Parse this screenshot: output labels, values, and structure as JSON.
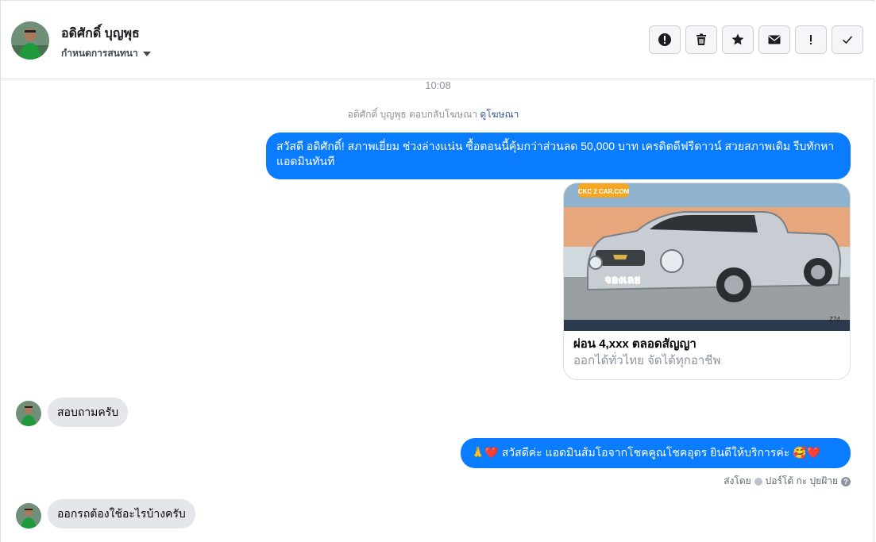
{
  "header": {
    "name": "อดิศักดิ์ บุญพุธ",
    "subtitle": "กำหนดการสนทนา",
    "toolbar": [
      {
        "icon": "alert-circle-icon"
      },
      {
        "icon": "trash-icon"
      },
      {
        "icon": "star-icon"
      },
      {
        "icon": "mail-icon"
      },
      {
        "icon": "exclamation-icon"
      },
      {
        "icon": "checkmark-icon"
      }
    ]
  },
  "conversation": {
    "timestamp": "10:08",
    "ad_reply_text": "อดิศักดิ์ บุญพุธ ตอบกลับโฆษณา",
    "ad_reply_link": "ดูโฆษณา",
    "messages": [
      {
        "from": "page",
        "text": "สวัสดี อดิศักดิ์!  สภาพเยี่ยม ช่วงล่างแน่น  ซื้อตอนนี้คุ้มกว่าส่วนลด 50,000 บาท เครดิตดีฟรีดาวน์  สวยสภาพเดิม รีบทักหาแอดมินทันที"
      },
      {
        "from": "customer",
        "text": "สอบถามครับ"
      },
      {
        "from": "page",
        "text": "🙏❤️ สวัสดีค่ะ แอดมินส้มโอจากโชคคูณโชคอุดร ยินดีให้บริการค่ะ 🥰❤️"
      },
      {
        "from": "customer",
        "text": "ออกรถต้องใช้อะไรบ้างครับ"
      }
    ],
    "ad_card": {
      "title": "ผ่อน 4,xxx ตลอดสัญญา",
      "subtitle": "ออกได้ทั่วไทย จัดได้ทุกอาชีพ",
      "image_labels": {
        "brand": "CKC 2 CAR.COM",
        "stamp": "จองเลย",
        "code": "Z74"
      }
    },
    "sent_by_prefix": "ส่งโดย",
    "sent_by_name": "ปอร์โต้ กะ ปุยฝ้าย"
  },
  "colors": {
    "accent": "#0a7cff",
    "incoming": "#e4e6eb",
    "muted": "#90949c"
  }
}
